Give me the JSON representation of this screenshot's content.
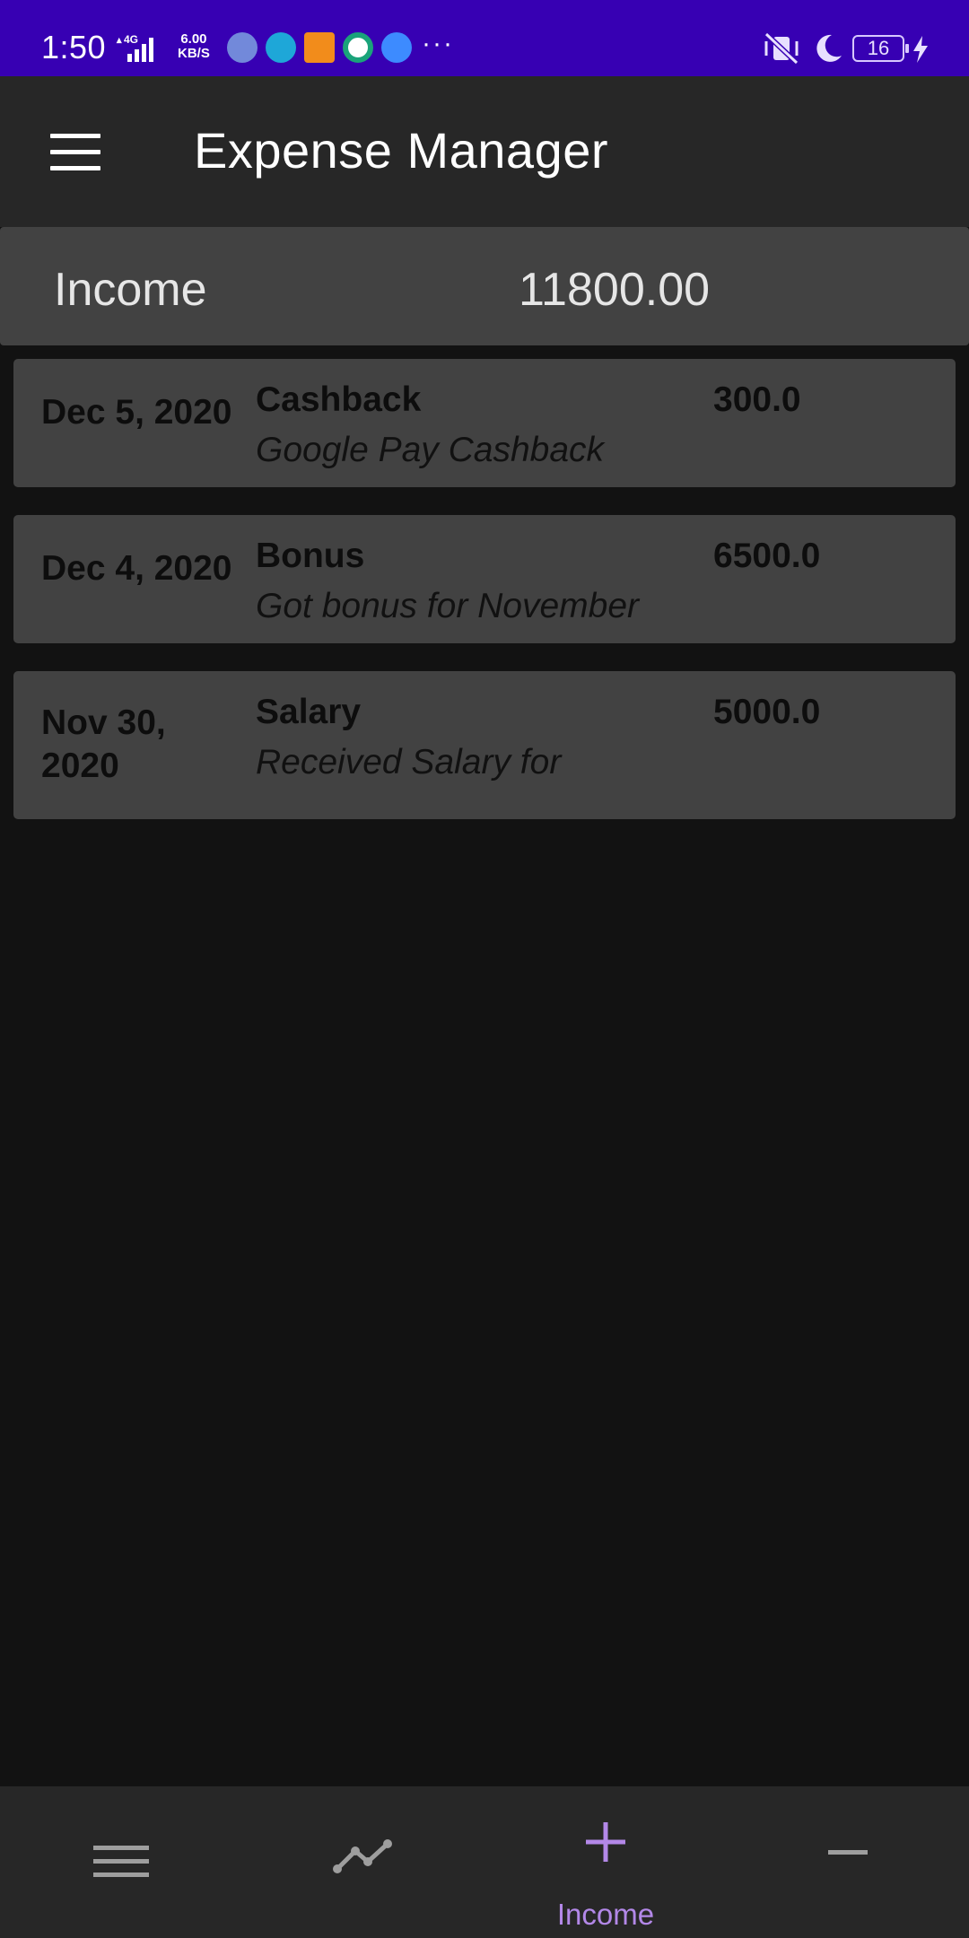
{
  "status_bar": {
    "time": "1:50",
    "network": "4G",
    "speed_value": "6.00",
    "speed_unit": "KB/S",
    "battery": "16",
    "overflow": "···",
    "colors": {
      "background": "#3700B3"
    }
  },
  "app_bar": {
    "title": "Expense Manager",
    "menu_icon": "hamburger-menu-icon"
  },
  "summary": {
    "label": "Income",
    "total": "11800.00"
  },
  "entries": [
    {
      "date": "Dec 5, 2020",
      "title": "Cashback",
      "description": "Google Pay Cashback",
      "amount": "300.0"
    },
    {
      "date": "Dec 4, 2020",
      "title": "Bonus",
      "description": "Got bonus for November",
      "amount": "6500.0"
    },
    {
      "date": "Nov 30, 2020",
      "title": "Salary",
      "description": "Received Salary for",
      "amount": "5000.0"
    }
  ],
  "bottom_nav": {
    "items": [
      {
        "icon": "list-icon",
        "label": ""
      },
      {
        "icon": "trend-chart-icon",
        "label": ""
      },
      {
        "icon": "plus-icon",
        "label": "Income",
        "selected": true
      },
      {
        "icon": "minus-icon",
        "label": ""
      }
    ],
    "colors": {
      "selected": "#b388e8",
      "unselected": "#9e9e9e"
    }
  }
}
